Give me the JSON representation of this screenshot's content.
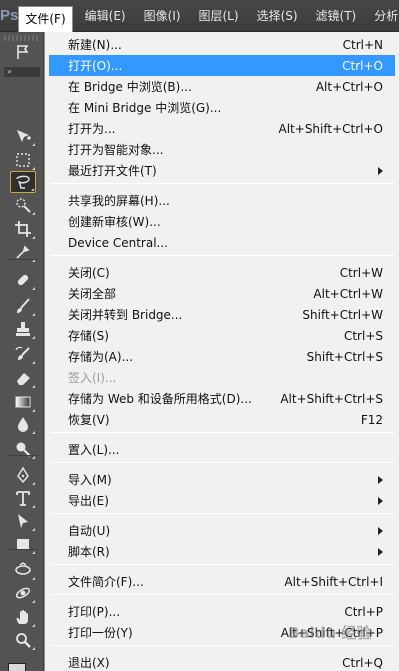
{
  "menubar": {
    "logo": "Ps",
    "menus": [
      "文件(F)",
      "编辑(E)",
      "图像(I)",
      "图层(L)",
      "选择(S)",
      "滤镜(T)",
      "分析"
    ]
  },
  "toolbar": {
    "collapse_glyph": "»",
    "tools": [
      {
        "name": "move-tool-icon"
      },
      {
        "name": "marquee-tool-icon"
      },
      {
        "name": "lasso-tool-icon"
      },
      {
        "name": "quick-selection-tool-icon"
      },
      {
        "name": "crop-tool-icon"
      },
      {
        "name": "eyedropper-tool-icon"
      },
      {
        "name": "spot-healing-tool-icon"
      },
      {
        "name": "brush-tool-icon"
      },
      {
        "name": "clone-stamp-tool-icon"
      },
      {
        "name": "history-brush-tool-icon"
      },
      {
        "name": "eraser-tool-icon"
      },
      {
        "name": "gradient-tool-icon"
      },
      {
        "name": "blur-tool-icon"
      },
      {
        "name": "dodge-tool-icon"
      },
      {
        "name": "pen-tool-icon"
      },
      {
        "name": "type-tool-icon"
      },
      {
        "name": "path-selection-tool-icon"
      },
      {
        "name": "rectangle-tool-icon"
      },
      {
        "name": "3d-rotate-tool-icon"
      },
      {
        "name": "3d-orbit-tool-icon"
      },
      {
        "name": "hand-tool-icon"
      },
      {
        "name": "zoom-tool-icon"
      }
    ]
  },
  "file_menu": {
    "items": [
      {
        "label": "新建(N)...",
        "shortcut": "Ctrl+N"
      },
      {
        "label": "打开(O)...",
        "shortcut": "Ctrl+O",
        "highlight": true
      },
      {
        "label": "在 Bridge 中浏览(B)...",
        "shortcut": "Alt+Ctrl+O"
      },
      {
        "label": "在 Mini Bridge 中浏览(G)...",
        "shortcut": ""
      },
      {
        "label": "打开为...",
        "shortcut": "Alt+Shift+Ctrl+O"
      },
      {
        "label": "打开为智能对象...",
        "shortcut": ""
      },
      {
        "label": "最近打开文件(T)",
        "shortcut": "",
        "submenu": true
      },
      {
        "divider": true
      },
      {
        "label": "共享我的屏幕(H)...",
        "shortcut": ""
      },
      {
        "label": "创建新审核(W)...",
        "shortcut": ""
      },
      {
        "label": "Device Central...",
        "shortcut": ""
      },
      {
        "divider": true
      },
      {
        "label": "关闭(C)",
        "shortcut": "Ctrl+W"
      },
      {
        "label": "关闭全部",
        "shortcut": "Alt+Ctrl+W"
      },
      {
        "label": "关闭并转到 Bridge...",
        "shortcut": "Shift+Ctrl+W"
      },
      {
        "label": "存储(S)",
        "shortcut": "Ctrl+S"
      },
      {
        "label": "存储为(A)...",
        "shortcut": "Shift+Ctrl+S"
      },
      {
        "label": "签入(I)...",
        "shortcut": "",
        "disabled": true
      },
      {
        "label": "存储为 Web 和设备所用格式(D)...",
        "shortcut": "Alt+Shift+Ctrl+S"
      },
      {
        "label": "恢复(V)",
        "shortcut": "F12"
      },
      {
        "divider": true
      },
      {
        "label": "置入(L)...",
        "shortcut": ""
      },
      {
        "divider": true
      },
      {
        "label": "导入(M)",
        "shortcut": "",
        "submenu": true
      },
      {
        "label": "导出(E)",
        "shortcut": "",
        "submenu": true
      },
      {
        "divider": true
      },
      {
        "label": "自动(U)",
        "shortcut": "",
        "submenu": true
      },
      {
        "label": "脚本(R)",
        "shortcut": "",
        "submenu": true
      },
      {
        "divider": true
      },
      {
        "label": "文件简介(F)...",
        "shortcut": "Alt+Shift+Ctrl+I"
      },
      {
        "divider": true
      },
      {
        "label": "打印(P)...",
        "shortcut": "Ctrl+P"
      },
      {
        "label": "打印一份(Y)",
        "shortcut": "Alt+Shift+Ctrl+P"
      },
      {
        "divider": true
      },
      {
        "label": "退出(X)",
        "shortcut": "Ctrl+Q"
      }
    ]
  },
  "watermark": "Baidu 经验",
  "colors": {
    "highlight": "#3399ff",
    "menu_bg": "#f1f1f1",
    "menubar_bg": "#3c3c3c",
    "toolbar_bg": "#535353"
  }
}
